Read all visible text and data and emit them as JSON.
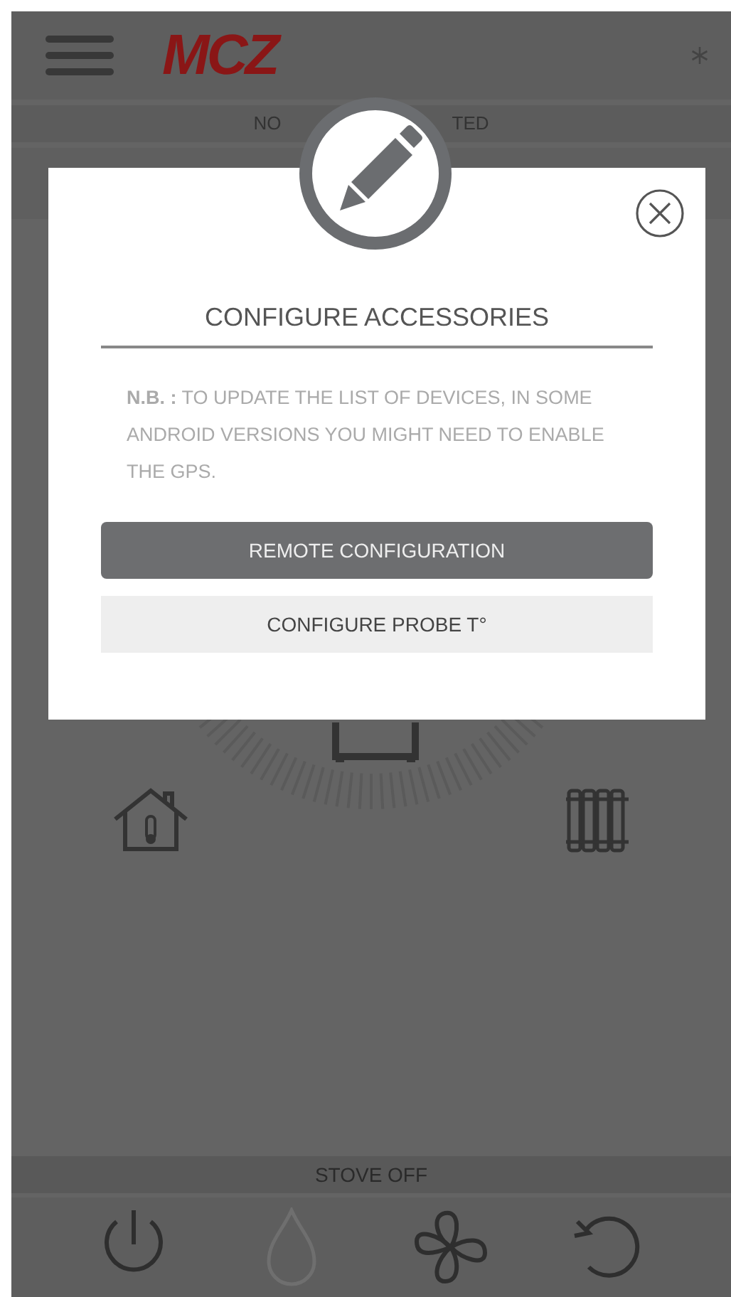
{
  "header": {
    "logo": "MCZ"
  },
  "connection_fragments": [
    "NO",
    "TED"
  ],
  "dialog": {
    "title": "CONFIGURE ACCESSORIES",
    "note": "**N.B. :** TO UPDATE THE LIST OF DEVICES, IN SOME ANDROID VERSIONS YOU MIGHT NEED TO ENABLE THE GPS.",
    "buttons": [
      {
        "label": "REMOTE CONFIGURATION",
        "kind": "primary"
      },
      {
        "label": "CONFIGURE PROBE T°",
        "kind": "secondary"
      }
    ]
  },
  "status_bar": "STOVE OFF",
  "toolbar": [
    {
      "kind": "power",
      "disabled": false
    },
    {
      "kind": "flame",
      "disabled": true
    },
    {
      "kind": "fan",
      "disabled": false
    },
    {
      "kind": "reload",
      "disabled": false
    }
  ]
}
